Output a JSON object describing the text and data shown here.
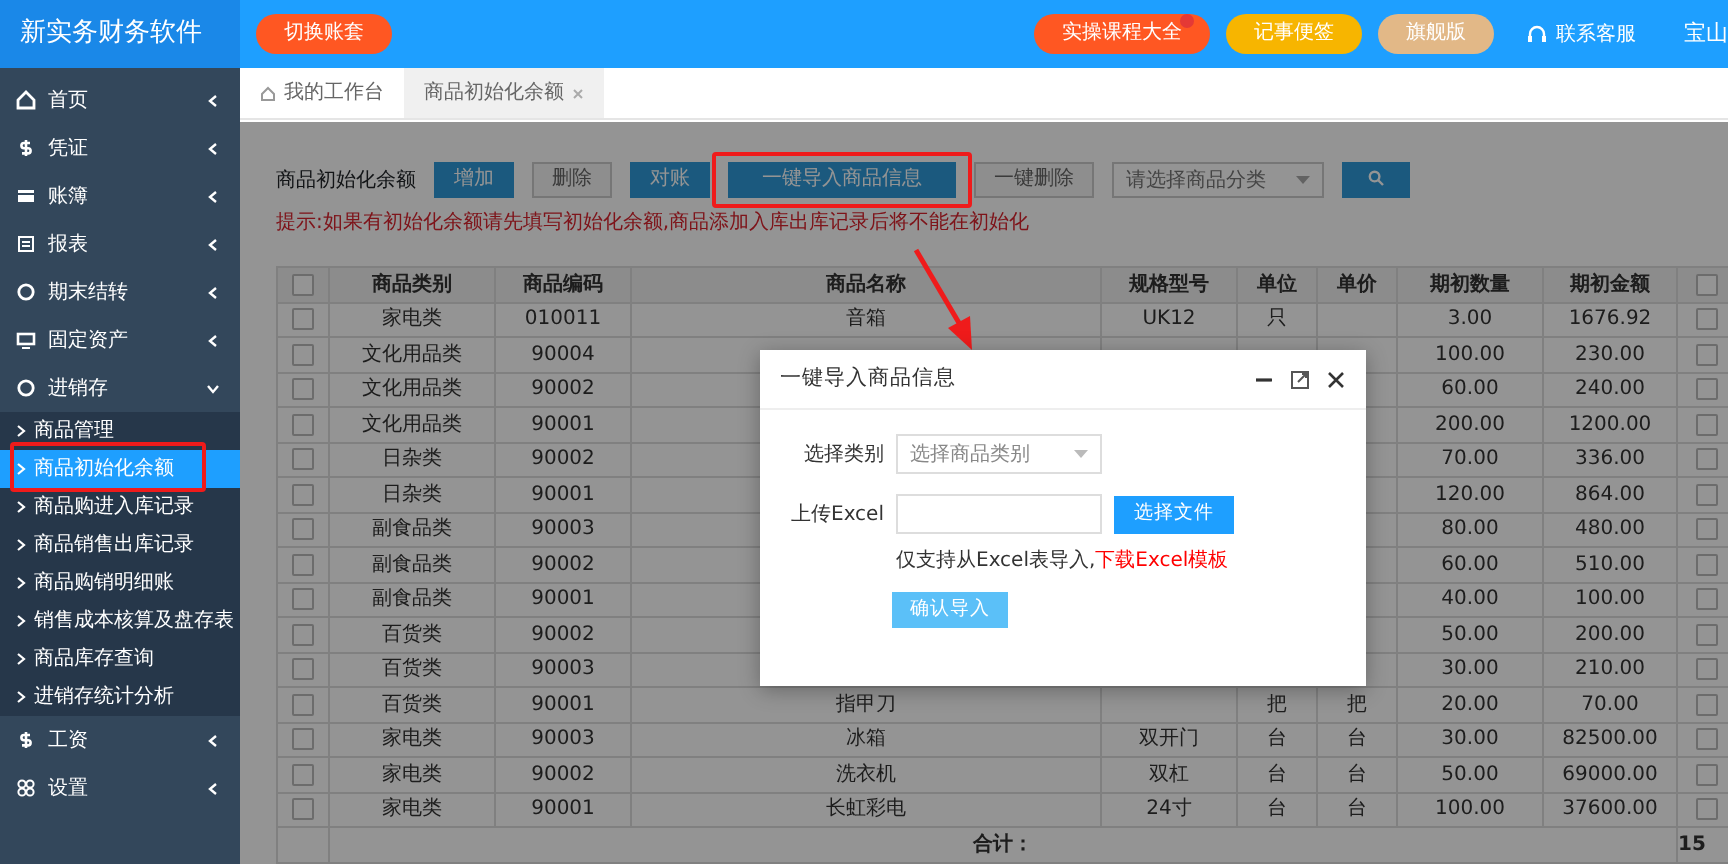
{
  "app_title": "新实务财务软件",
  "topbar": {
    "switch_button": "切换账套",
    "buttons": [
      {
        "label": "实操课程大全",
        "color": "#ff5722",
        "badge": true
      },
      {
        "label": "记事便签",
        "color": "#f7b500",
        "badge": false
      },
      {
        "label": "旗舰版",
        "color": "#e2b887",
        "badge": false
      }
    ],
    "support": "联系客服",
    "user": "宝山"
  },
  "sidebar": {
    "items": [
      {
        "label": "首页",
        "expanded": false
      },
      {
        "label": "凭证",
        "expanded": false
      },
      {
        "label": "账簿",
        "expanded": false
      },
      {
        "label": "报表",
        "expanded": false
      },
      {
        "label": "期末结转",
        "expanded": false
      },
      {
        "label": "固定资产",
        "expanded": false
      },
      {
        "label": "进销存",
        "expanded": true,
        "children": [
          {
            "label": "商品管理",
            "selected": false
          },
          {
            "label": "商品初始化余额",
            "selected": true
          },
          {
            "label": "商品购进入库记录",
            "selected": false
          },
          {
            "label": "商品销售出库记录",
            "selected": false
          },
          {
            "label": "商品购销明细账",
            "selected": false
          },
          {
            "label": "销售成本核算及盘存表",
            "selected": false
          },
          {
            "label": "商品库存查询",
            "selected": false
          },
          {
            "label": "进销存统计分析",
            "selected": false
          }
        ]
      },
      {
        "label": "工资",
        "expanded": false
      },
      {
        "label": "设置",
        "expanded": false
      }
    ]
  },
  "tabs": [
    {
      "label": "我的工作台",
      "selected": false,
      "closable": false
    },
    {
      "label": "商品初始化余额",
      "selected": true,
      "closable": true
    }
  ],
  "toolbar": {
    "label": "商品初始化余额",
    "buttons": [
      {
        "label": "增加",
        "kind": "primary"
      },
      {
        "label": "删除",
        "kind": "default"
      },
      {
        "label": "对账",
        "kind": "primary"
      },
      {
        "label": "一键导入商品信息",
        "kind": "primary"
      },
      {
        "label": "一键删除",
        "kind": "default"
      }
    ],
    "category_select": {
      "placeholder": "请选择商品分类"
    }
  },
  "hint": "提示:如果有初始化余额请先填写初始化余额,商品添加入库出库记录后将不能在初始化",
  "table": {
    "all_checked": false,
    "columns": [
      "商品类别",
      "商品编码",
      "商品名称",
      "规格型号",
      "单位",
      "单价",
      "期初数量",
      "期初金额"
    ],
    "rows": [
      {
        "checked": false,
        "cells": [
          "家电类",
          "010011",
          "音箱",
          "UK12",
          "只",
          null,
          "3.00",
          "1676.92"
        ]
      },
      {
        "checked": false,
        "cells": [
          "文化用品类",
          "90004",
          null,
          null,
          null,
          null,
          "100.00",
          "230.00"
        ]
      },
      {
        "checked": false,
        "cells": [
          "文化用品类",
          "90002",
          null,
          null,
          null,
          null,
          "60.00",
          "240.00"
        ]
      },
      {
        "checked": false,
        "cells": [
          "文化用品类",
          "90001",
          null,
          null,
          null,
          null,
          "200.00",
          "1200.00"
        ]
      },
      {
        "checked": false,
        "cells": [
          "日杂类",
          "90002",
          null,
          null,
          null,
          null,
          "70.00",
          "336.00"
        ]
      },
      {
        "checked": false,
        "cells": [
          "日杂类",
          "90001",
          null,
          null,
          null,
          null,
          "120.00",
          "864.00"
        ]
      },
      {
        "checked": false,
        "cells": [
          "副食品类",
          "90003",
          null,
          null,
          null,
          null,
          "80.00",
          "480.00"
        ]
      },
      {
        "checked": false,
        "cells": [
          "副食品类",
          "90002",
          null,
          null,
          null,
          null,
          "60.00",
          "510.00"
        ]
      },
      {
        "checked": false,
        "cells": [
          "副食品类",
          "90001",
          null,
          null,
          null,
          null,
          "40.00",
          "100.00"
        ]
      },
      {
        "checked": false,
        "cells": [
          "百货类",
          "90002",
          null,
          null,
          null,
          null,
          "50.00",
          "200.00"
        ]
      },
      {
        "checked": false,
        "cells": [
          "百货类",
          "90003",
          null,
          null,
          null,
          null,
          "30.00",
          "210.00"
        ]
      },
      {
        "checked": false,
        "cells": [
          "百货类",
          "90001",
          "指甲刀",
          null,
          "把",
          "把",
          "20.00",
          "70.00"
        ]
      },
      {
        "checked": false,
        "cells": [
          "家电类",
          "90003",
          "冰箱",
          "双开门",
          "台",
          "台",
          "30.00",
          "82500.00"
        ]
      },
      {
        "checked": false,
        "cells": [
          "家电类",
          "90002",
          "洗衣机",
          "双杠",
          "台",
          "台",
          "50.00",
          "69000.00"
        ]
      },
      {
        "checked": false,
        "cells": [
          "家电类",
          "90001",
          "长虹彩电",
          "24寸",
          "台",
          "台",
          "100.00",
          "37600.00"
        ]
      }
    ],
    "footer": {
      "label": "合计：",
      "last": "15"
    }
  },
  "modal": {
    "title": "一键导入商品信息",
    "category_label": "选择类别",
    "category_placeholder": "选择商品类别",
    "upload_label": "上传Excel",
    "file_button": "选择文件",
    "note": "仅支持从Excel表导入,",
    "template_link": "下载Excel模板",
    "confirm_button": "确认导入"
  }
}
